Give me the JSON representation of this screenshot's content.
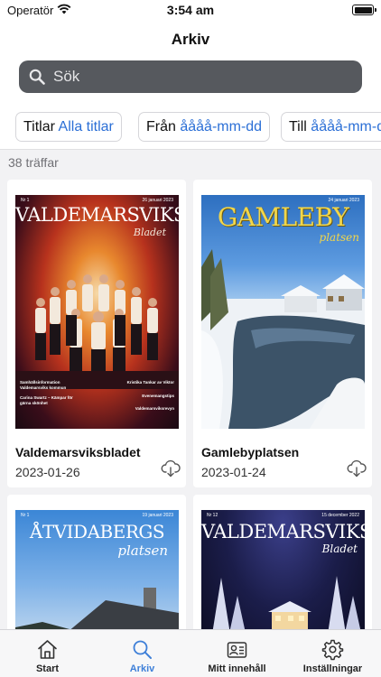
{
  "status_bar": {
    "carrier": "Operatör",
    "time": "3:54 am"
  },
  "nav": {
    "title": "Arkiv"
  },
  "search": {
    "placeholder": "Sök"
  },
  "filters": [
    {
      "key": "Titlar",
      "value": "Alla titlar"
    },
    {
      "key": "Från",
      "value": "åååå-mm-dd"
    },
    {
      "key": "Till",
      "value": "åååå-mm-dd"
    }
  ],
  "results_count": "38 träffar",
  "issues": [
    {
      "title": "Valdemarsviksbladet",
      "date": "2023-01-26",
      "cover": {
        "masthead": "VALDEMARSVIKS",
        "subtitle": "Bladet",
        "issue_no": "Nr 1",
        "issue_date": "26 januari 2023",
        "blurbs": [
          "Samhällsinformation Valdemarsviks kommun",
          "Carina Swartz – Kämpar för gärna skönhet",
          "Kristika Tankar av Viktor",
          "Evenemangstips",
          "Valdemarsviksrevyn"
        ]
      }
    },
    {
      "title": "Gamlebyplatsen",
      "date": "2023-01-24",
      "cover": {
        "masthead": "GAMLEBY",
        "subtitle": "platsen",
        "issue_date": "24 januari 2023"
      }
    },
    {
      "title": "",
      "date": "",
      "cover": {
        "masthead": "ÅTVIDABERGS",
        "subtitle": "platsen",
        "issue_no": "Nr 1",
        "issue_date": "19 januari 2023"
      }
    },
    {
      "title": "",
      "date": "",
      "cover": {
        "masthead": "VALDEMARSVIKS",
        "subtitle": "Bladet",
        "issue_no": "Nr 12",
        "issue_date": "15 december 2022"
      }
    }
  ],
  "tabs": [
    {
      "label": "Start",
      "icon": "home-icon"
    },
    {
      "label": "Arkiv",
      "icon": "search-icon",
      "active": true
    },
    {
      "label": "Mitt innehåll",
      "icon": "person-card-icon"
    },
    {
      "label": "Inställningar",
      "icon": "gear-icon"
    }
  ],
  "colors": {
    "accent": "#3e7fd8",
    "search_bg": "#56595e",
    "filter_value": "#2b6fd6"
  }
}
